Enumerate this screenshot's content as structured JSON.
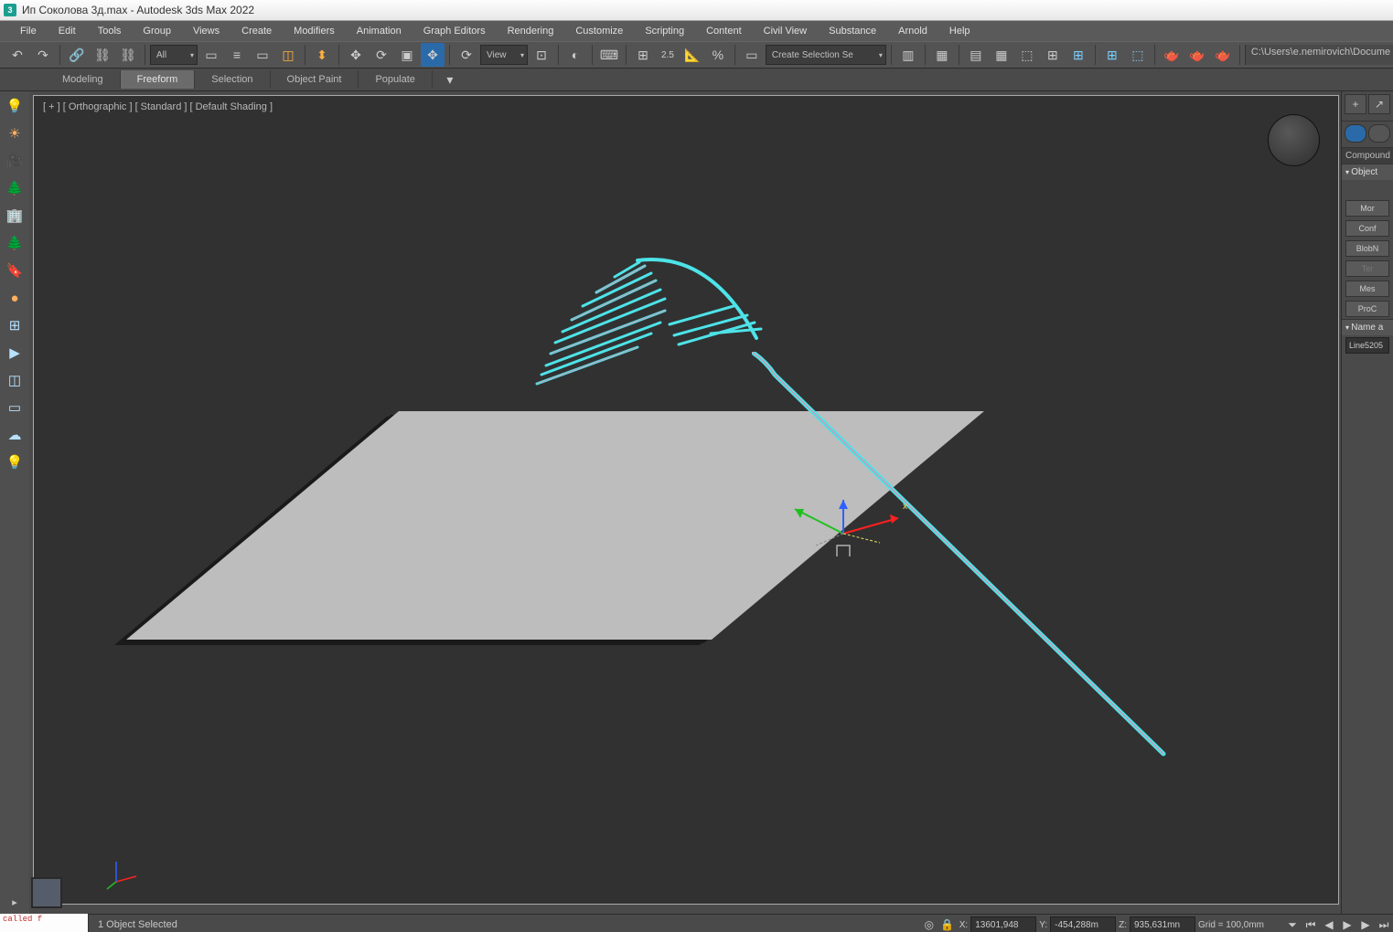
{
  "title": "Ип Соколова 3д.max - Autodesk 3ds Max 2022",
  "logo": "3",
  "menu": [
    "File",
    "Edit",
    "Tools",
    "Group",
    "Views",
    "Create",
    "Modifiers",
    "Animation",
    "Graph Editors",
    "Rendering",
    "Customize",
    "Scripting",
    "Content",
    "Civil View",
    "Substance",
    "Arnold",
    "Help"
  ],
  "toolbar1": {
    "all_filter": "All",
    "view_mode": "View",
    "angle": "2.5",
    "selection_set": "Create Selection Se"
  },
  "ribbon_tabs": [
    "Modeling",
    "Freeform",
    "Selection",
    "Object Paint",
    "Populate"
  ],
  "ribbon_active": 1,
  "viewport": {
    "label": "[ + ] [ Orthographic ] [ Standard ] [ Default Shading ]",
    "gizmo_x": "x"
  },
  "right_panel": {
    "category": "Compound",
    "rollout1": "Object",
    "buttons": [
      "Mor",
      "Conf",
      "BlobN",
      "Ter",
      "Mes",
      "ProC"
    ],
    "rollout2": "Name a",
    "object_name": "Line5205"
  },
  "status": {
    "script_out": "called f",
    "selection": "1 Object Selected",
    "x": "13601,948",
    "y": "-454,288m",
    "z": "935,631mn",
    "grid": "Grid = 100,0mm"
  },
  "path": "C:\\Users\\e.nemirovich\\Docume"
}
